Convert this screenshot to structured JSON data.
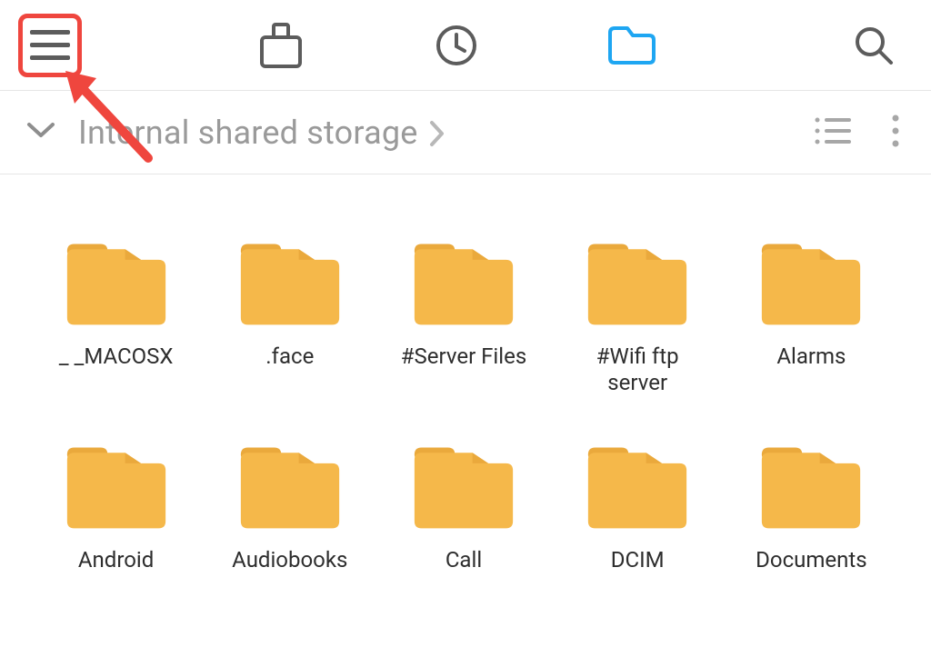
{
  "toolbar": {
    "icons": {
      "menu": "menu-icon",
      "analysis": "analysis-icon",
      "recent": "clock-icon",
      "files": "folder-outline-icon",
      "search": "search-icon"
    },
    "active_tab": "files"
  },
  "path": {
    "title": "Internal shared storage",
    "actions": {
      "viewMode": "list-view-icon",
      "more": "more-vert-icon"
    }
  },
  "folders": [
    {
      "label": "_ _MACOSX"
    },
    {
      "label": ".face"
    },
    {
      "label": "#Server Files"
    },
    {
      "label": "#Wifi ftp server"
    },
    {
      "label": "Alarms"
    },
    {
      "label": "Android"
    },
    {
      "label": "Audiobooks"
    },
    {
      "label": "Call"
    },
    {
      "label": "DCIM"
    },
    {
      "label": "Documents"
    }
  ],
  "colors": {
    "icon_gray": "#5c5c5c",
    "icon_light": "#a7a7a7",
    "icon_active": "#1ea6f2",
    "folder_fill": "#f5b84a",
    "folder_tab": "#eaa93c",
    "annotation_red": "#ef463e"
  }
}
